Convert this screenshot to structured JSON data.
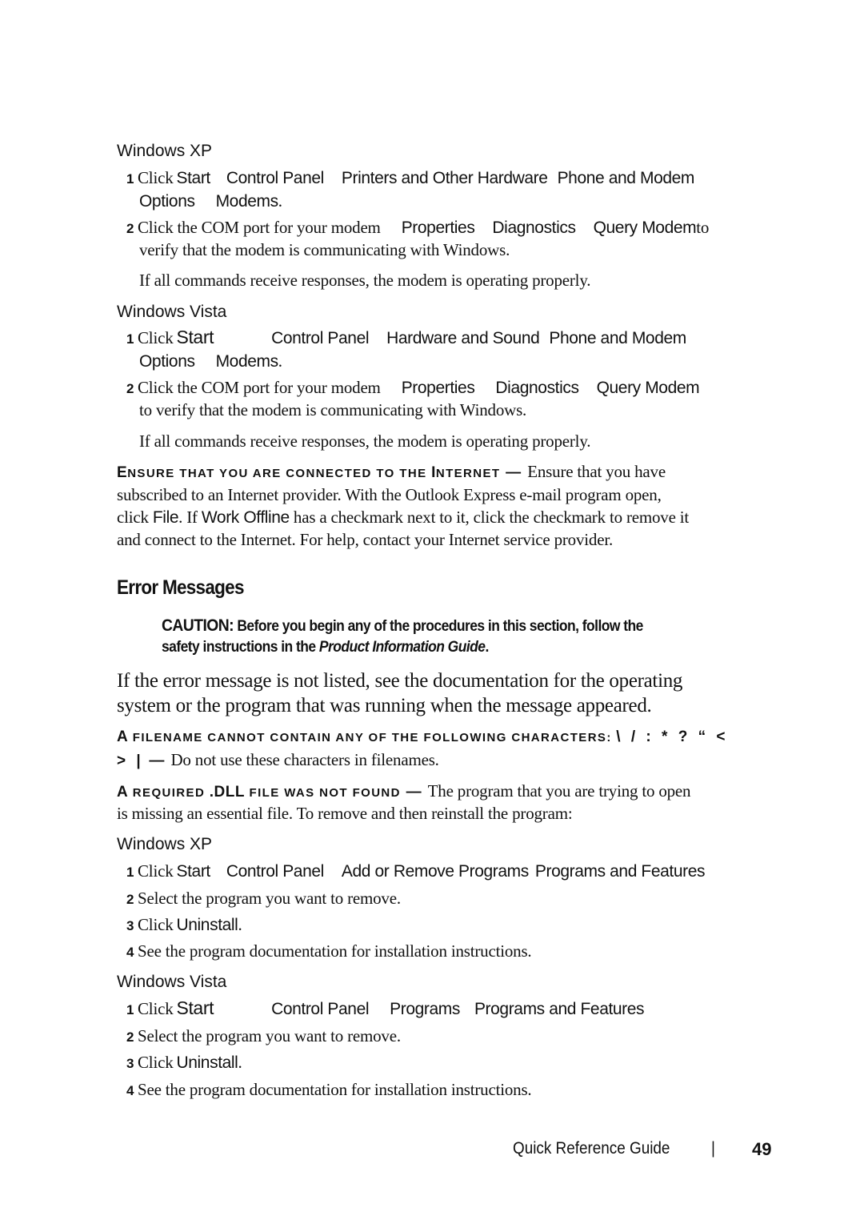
{
  "modem_check": {
    "xp": {
      "heading": "Windows XP",
      "step1": {
        "num": "1",
        "click": "Click",
        "start": "Start",
        "p1": "Control Panel",
        "p2": "Printers and Other Hardware",
        "p3": "Phone and Modem",
        "p4": "Options",
        "p5": "Modems",
        "end": "."
      },
      "step2": {
        "num": "2",
        "text": "Click the COM port for your modem",
        "p1": "Properties",
        "p2": "Diagnostics",
        "p3": "Query Modem",
        "tail": "to",
        "line2": "verify that the modem is communicating with Windows."
      },
      "note": "If all commands receive responses, the modem is operating properly."
    },
    "vista": {
      "heading": "Windows Vista",
      "step1": {
        "num": "1",
        "click": "Click",
        "start": "Start",
        "p1": "Control Panel",
        "p2": "Hardware and Sound",
        "p3": "Phone and Modem",
        "p4": "Options",
        "p5": "Modems",
        "end": "."
      },
      "step2": {
        "num": "2",
        "text": "Click the COM port for your modem",
        "p1": "Properties",
        "p2": "Diagnostics",
        "p3": "Query Modem",
        "line2": "to verify that the modem is communicating with Windows."
      },
      "note": "If all commands receive responses, the modem is operating properly."
    }
  },
  "internet": {
    "title_cap1": "E",
    "title_rest1": "NSURE THAT YOU ARE CONNECTED TO THE ",
    "title_cap2": "I",
    "title_rest2": "NTERNET",
    "dash": " — ",
    "line1": "Ensure that you have",
    "line2": "subscribed to an Internet provider. With the Outlook Express e-mail program open,",
    "line3_a": "click ",
    "file": "File",
    "line3_b": ". If ",
    "work_offline": "Work Offline",
    "line3_c": " has a checkmark next to it, click the checkmark to remove it",
    "line4": "and connect to the Internet. For help, contact your Internet service provider."
  },
  "error_messages": {
    "heading": "Error Messages",
    "caution_label": "CAUTION:",
    "caution_text1": " Before you begin any of the procedures in this section, follow the",
    "caution_text2a": "safety instructions in the ",
    "caution_guide": "Product Information Guide",
    "caution_text2b": ".",
    "intro1": "If the error message is not listed, see the documentation for the operating",
    "intro2": "system or the program that was running when the message appeared.",
    "filename": {
      "cap": "A",
      "title": " FILENAME CANNOT CONTAIN ANY OF THE FOLLOWING CHARACTERS: ",
      "chars1": "\\ / : * ? “ <",
      "chars2": "> |",
      "dash": " — ",
      "text": "Do not use these characters in filenames."
    },
    "dll": {
      "cap": "A",
      "title_a": " REQUIRED ",
      "title_dll": ".DLL",
      "title_b": " FILE WAS NOT FOUND",
      "dash": " — ",
      "text1": "The program that you are trying to open",
      "text2": "is missing an essential file. To remove and then reinstall the program:"
    },
    "xp": {
      "heading": "Windows XP",
      "step1": {
        "num": "1",
        "click": "Click",
        "start": "Start",
        "p1": "Control Panel",
        "p2": "Add or Remove Programs",
        "p3": "Programs and Features"
      },
      "step2": {
        "num": "2",
        "text": "Select the program you want to remove."
      },
      "step3": {
        "num": "3",
        "click": "Click",
        "uninstall": "Uninstall",
        "end": "."
      },
      "step4": {
        "num": "4",
        "text": "See the program documentation for installation instructions."
      }
    },
    "vista": {
      "heading": "Windows Vista",
      "step1": {
        "num": "1",
        "click": "Click",
        "start": "Start",
        "p1": "Control Panel",
        "p2": "Programs",
        "p3": "Programs and Features"
      },
      "step2": {
        "num": "2",
        "text": "Select the program you want to remove."
      },
      "step3": {
        "num": "3",
        "click": "Click",
        "uninstall": "Uninstall",
        "end": "."
      },
      "step4": {
        "num": "4",
        "text": "See the program documentation for installation instructions."
      }
    }
  },
  "footer": {
    "guide": "Quick Reference Guide",
    "separator": "|",
    "page": "49"
  }
}
